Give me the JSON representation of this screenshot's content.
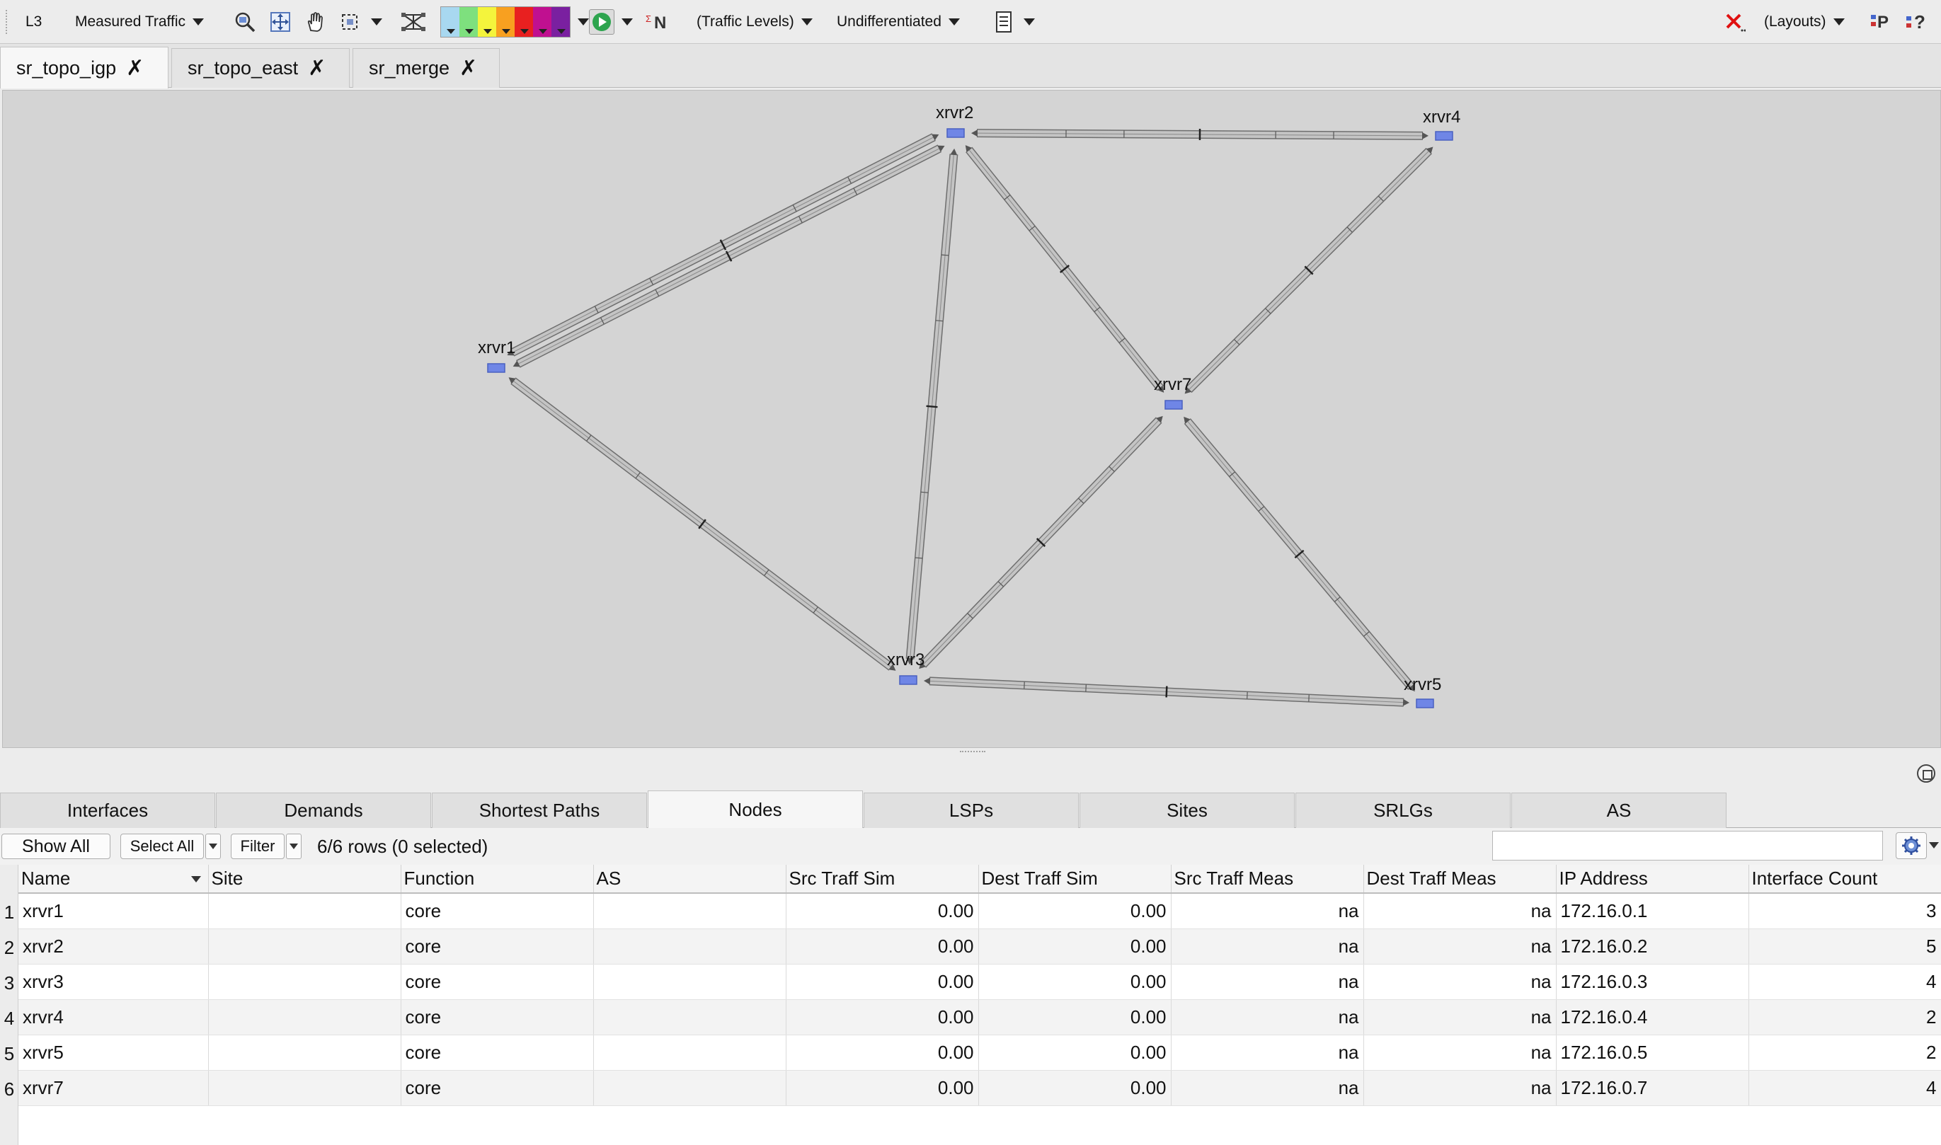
{
  "toolbar": {
    "layer": "L3",
    "traffic_mode": "Measured Traffic",
    "legend_colors": [
      "#a8d8f0",
      "#7ee07e",
      "#f4f43c",
      "#f8a020",
      "#e82020",
      "#c01090",
      "#7a20a0"
    ],
    "traffic_levels": "(Traffic Levels)",
    "class_select": "Undifferentiated",
    "layouts": "(Layouts)",
    "icons": [
      "zoom-icon",
      "fit-icon",
      "pan-hand-icon",
      "select-rect-icon",
      "network-icon",
      "play-icon",
      "n-icon",
      "report-icon",
      "clear-x-icon",
      "plan-icon",
      "help-icon"
    ]
  },
  "doc_tabs": [
    {
      "label": "sr_topo_igp",
      "active": true
    },
    {
      "label": "sr_topo_east",
      "active": false
    },
    {
      "label": "sr_merge",
      "active": false
    }
  ],
  "canvas": {
    "background": "#d4d4d4",
    "nodes": [
      {
        "id": "xrvr1",
        "label": "xrvr1"
      },
      {
        "id": "xrvr2",
        "label": "xrvr2"
      },
      {
        "id": "xrvr3",
        "label": "xrvr3"
      },
      {
        "id": "xrvr4",
        "label": "xrvr4"
      },
      {
        "id": "xrvr5",
        "label": "xrvr5"
      },
      {
        "id": "xrvr7",
        "label": "xrvr7"
      }
    ],
    "links": [
      {
        "a": "xrvr1",
        "b": "xrvr2"
      },
      {
        "a": "xrvr1",
        "b": "xrvr2"
      },
      {
        "a": "xrvr1",
        "b": "xrvr3"
      },
      {
        "a": "xrvr2",
        "b": "xrvr3"
      },
      {
        "a": "xrvr2",
        "b": "xrvr4"
      },
      {
        "a": "xrvr2",
        "b": "xrvr7"
      },
      {
        "a": "xrvr4",
        "b": "xrvr7"
      },
      {
        "a": "xrvr3",
        "b": "xrvr7"
      },
      {
        "a": "xrvr7",
        "b": "xrvr5"
      },
      {
        "a": "xrvr3",
        "b": "xrvr5"
      }
    ]
  },
  "bottom_tabs": [
    {
      "label": "Interfaces",
      "active": false
    },
    {
      "label": "Demands",
      "active": false
    },
    {
      "label": "Shortest Paths",
      "active": false
    },
    {
      "label": "Nodes",
      "active": true
    },
    {
      "label": "LSPs",
      "active": false
    },
    {
      "label": "Sites",
      "active": false
    },
    {
      "label": "SRLGs",
      "active": false
    },
    {
      "label": "AS",
      "active": false
    }
  ],
  "table_toolbar": {
    "show_all": "Show All",
    "select_all": "Select All",
    "filter": "Filter",
    "row_count": "6/6 rows (0 selected)",
    "search_value": ""
  },
  "table": {
    "columns": [
      "Name",
      "Site",
      "Function",
      "AS",
      "Src Traff Sim",
      "Dest Traff Sim",
      "Src Traff Meas",
      "Dest Traff Meas",
      "IP Address",
      "Interface Count"
    ],
    "rows": [
      [
        "xrvr1",
        "",
        "core",
        "",
        "0.00",
        "0.00",
        "na",
        "na",
        "172.16.0.1",
        "3"
      ],
      [
        "xrvr2",
        "",
        "core",
        "",
        "0.00",
        "0.00",
        "na",
        "na",
        "172.16.0.2",
        "5"
      ],
      [
        "xrvr3",
        "",
        "core",
        "",
        "0.00",
        "0.00",
        "na",
        "na",
        "172.16.0.3",
        "4"
      ],
      [
        "xrvr4",
        "",
        "core",
        "",
        "0.00",
        "0.00",
        "na",
        "na",
        "172.16.0.4",
        "2"
      ],
      [
        "xrvr5",
        "",
        "core",
        "",
        "0.00",
        "0.00",
        "na",
        "na",
        "172.16.0.5",
        "2"
      ],
      [
        "xrvr7",
        "",
        "core",
        "",
        "0.00",
        "0.00",
        "na",
        "na",
        "172.16.0.7",
        "4"
      ]
    ]
  }
}
